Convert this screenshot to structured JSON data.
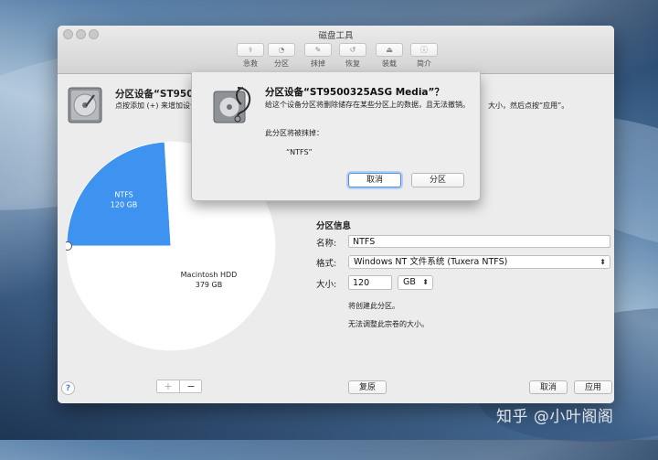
{
  "window": {
    "title": "磁盘工具"
  },
  "toolbar": [
    {
      "label": "急救",
      "icon": "stethoscope-icon"
    },
    {
      "label": "分区",
      "icon": "partition-icon"
    },
    {
      "label": "抹掉",
      "icon": "erase-icon"
    },
    {
      "label": "恢复",
      "icon": "restore-icon"
    },
    {
      "label": "装载",
      "icon": "mount-icon"
    },
    {
      "label": "简介",
      "icon": "info-icon"
    }
  ],
  "device": {
    "title": "分区设备“ST9500",
    "hint": "点按添加 (+) 来增加设备",
    "hint_right": "大小，然后点按“应用”。"
  },
  "chart_data": {
    "type": "pie",
    "slices": [
      {
        "name": "NTFS",
        "size": "120 GB",
        "value": 120,
        "color": "#3e93f0"
      },
      {
        "name": "Macintosh HDD",
        "size": "379 GB",
        "value": 379,
        "color": "#ffffff"
      }
    ]
  },
  "partition_info": {
    "heading": "分区信息",
    "name_label": "名称:",
    "name_value": "NTFS",
    "format_label": "格式:",
    "format_value": "Windows NT 文件系统 (Tuxera NTFS)",
    "size_label": "大小:",
    "size_value": "120",
    "size_unit": "GB",
    "note1": "将创建此分区。",
    "note2": "无法调整此宗卷的大小。"
  },
  "bottom": {
    "help": "?",
    "plus": "+",
    "minus": "−",
    "revert": "复原",
    "cancel": "取消",
    "apply": "应用"
  },
  "sheet": {
    "title": "分区设备“ST9500325ASG Media”？",
    "message": "给这个设备分区将删除储存在某些分区上的数据，且无法撤销。",
    "will_erase": "此分区将被抹掉：",
    "partition": "“NTFS”",
    "cancel": "取消",
    "confirm": "分区"
  },
  "watermark": "知乎 @小叶阁阁"
}
